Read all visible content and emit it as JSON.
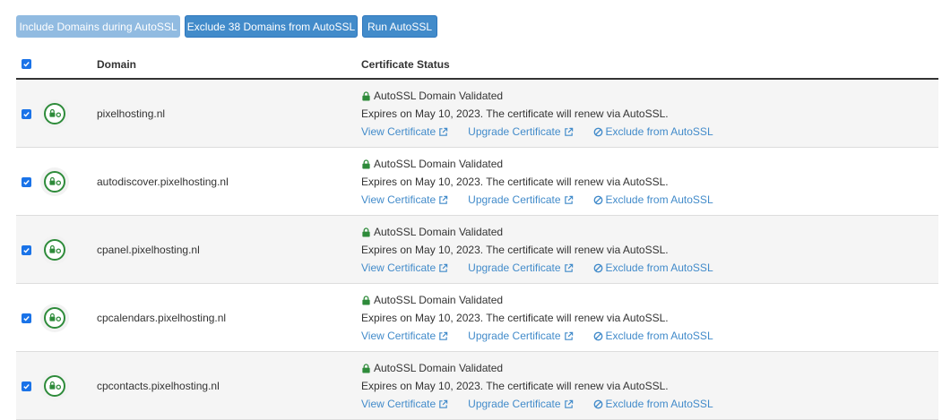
{
  "toolbar": {
    "include_label": "Include Domains during AutoSSL",
    "exclude_label": "Exclude 38 Domains from AutoSSL",
    "run_label": "Run AutoSSL"
  },
  "table": {
    "headers": {
      "domain": "Domain",
      "status": "Certificate Status"
    },
    "rows": [
      {
        "domain": "pixelhosting.nl",
        "status_title": "AutoSSL Domain Validated",
        "expires": "Expires on May 10, 2023. The certificate will renew via AutoSSL.",
        "view": "View Certificate",
        "upgrade": "Upgrade Certificate",
        "exclude": "Exclude from AutoSSL"
      },
      {
        "domain": "autodiscover.pixelhosting.nl",
        "status_title": "AutoSSL Domain Validated",
        "expires": "Expires on May 10, 2023. The certificate will renew via AutoSSL.",
        "view": "View Certificate",
        "upgrade": "Upgrade Certificate",
        "exclude": "Exclude from AutoSSL"
      },
      {
        "domain": "cpanel.pixelhosting.nl",
        "status_title": "AutoSSL Domain Validated",
        "expires": "Expires on May 10, 2023. The certificate will renew via AutoSSL.",
        "view": "View Certificate",
        "upgrade": "Upgrade Certificate",
        "exclude": "Exclude from AutoSSL"
      },
      {
        "domain": "cpcalendars.pixelhosting.nl",
        "status_title": "AutoSSL Domain Validated",
        "expires": "Expires on May 10, 2023. The certificate will renew via AutoSSL.",
        "view": "View Certificate",
        "upgrade": "Upgrade Certificate",
        "exclude": "Exclude from AutoSSL"
      },
      {
        "domain": "cpcontacts.pixelhosting.nl",
        "status_title": "AutoSSL Domain Validated",
        "expires": "Expires on May 10, 2023. The certificate will renew via AutoSSL.",
        "view": "View Certificate",
        "upgrade": "Upgrade Certificate",
        "exclude": "Exclude from AutoSSL"
      }
    ]
  },
  "colors": {
    "primary": "#428bca",
    "primary_disabled": "#8cb8e0",
    "checkbox": "#1a73e8",
    "lock_green": "#2e8b3a"
  },
  "icons": {
    "checkbox": "checkmark-icon",
    "row_status": "lock-key-icon",
    "validated": "lock-icon",
    "external": "external-link-icon",
    "exclude": "ban-icon"
  }
}
